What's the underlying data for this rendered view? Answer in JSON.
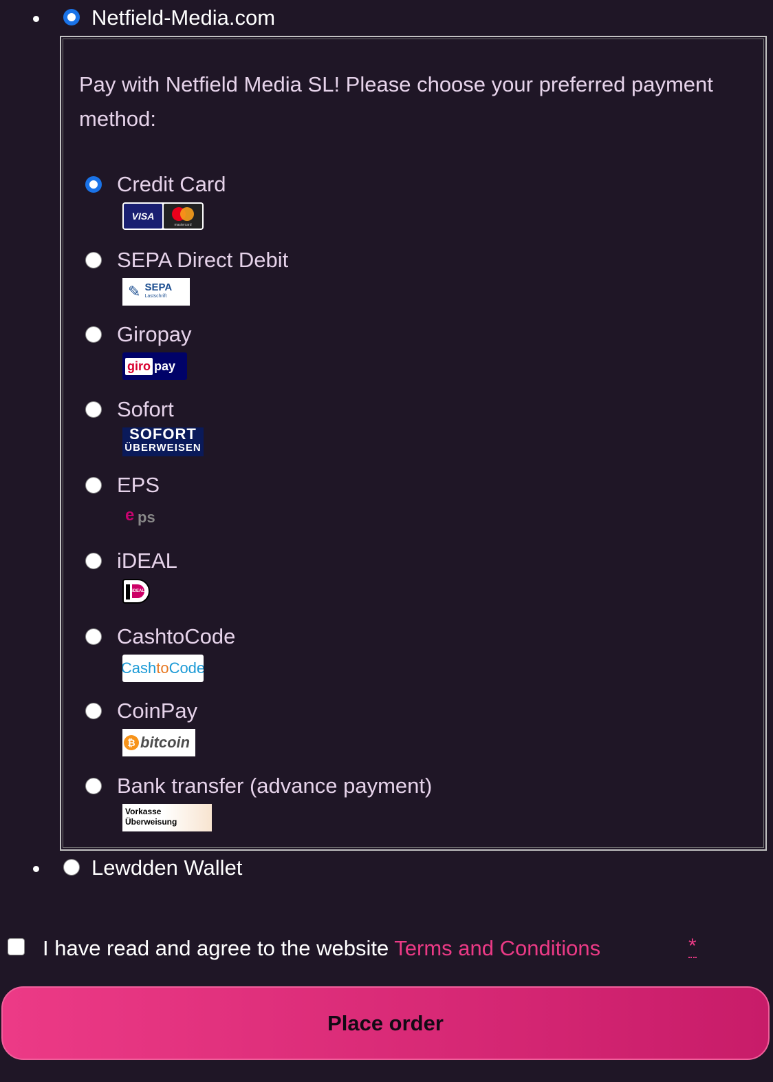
{
  "gateways": [
    {
      "label": "Netfield-Media.com",
      "selected": true
    },
    {
      "label": "Lewdden Wallet",
      "selected": false
    }
  ],
  "netfield": {
    "intro": "Pay with Netfield Media SL! Please choose your preferred payment method:",
    "methods": [
      {
        "label": "Credit Card",
        "selected": true,
        "logo": "visa-mastercard"
      },
      {
        "label": "SEPA Direct Debit",
        "selected": false,
        "logo": "sepa"
      },
      {
        "label": "Giropay",
        "selected": false,
        "logo": "giropay"
      },
      {
        "label": "Sofort",
        "selected": false,
        "logo": "sofort"
      },
      {
        "label": "EPS",
        "selected": false,
        "logo": "eps"
      },
      {
        "label": "iDEAL",
        "selected": false,
        "logo": "ideal"
      },
      {
        "label": "CashtoCode",
        "selected": false,
        "logo": "cashtocode"
      },
      {
        "label": "CoinPay",
        "selected": false,
        "logo": "bitcoin"
      },
      {
        "label": "Bank transfer (advance payment)",
        "selected": false,
        "logo": "vorkasse"
      }
    ],
    "logo_text": {
      "visa": "VISA",
      "mastercard": "mastercard",
      "sepa": "SEPA",
      "sepa_sub": "Lastschrift",
      "giro": "giro",
      "pay": "pay",
      "sofort_l1": "SOFORT",
      "sofort_l2": "ÜBERWEISEN",
      "eps_e": "e",
      "eps_ps": "ps",
      "ideal": "iDEAL",
      "cash": "Cash",
      "to": "to",
      "code": "Code",
      "btc_symbol": "₿",
      "btc_word": "bitcoin",
      "vorkasse": "Vorkasse",
      "ueberweisung": "Überweisung"
    }
  },
  "terms": {
    "text": "I have read and agree to the website ",
    "link": "Terms and Conditions",
    "required": "*",
    "checked": false
  },
  "place_order": "Place order",
  "colors": {
    "background": "#1f1626",
    "accent": "#ec3a86",
    "radio_selected": "#1a73e8",
    "text_muted": "#e6d3ea"
  }
}
